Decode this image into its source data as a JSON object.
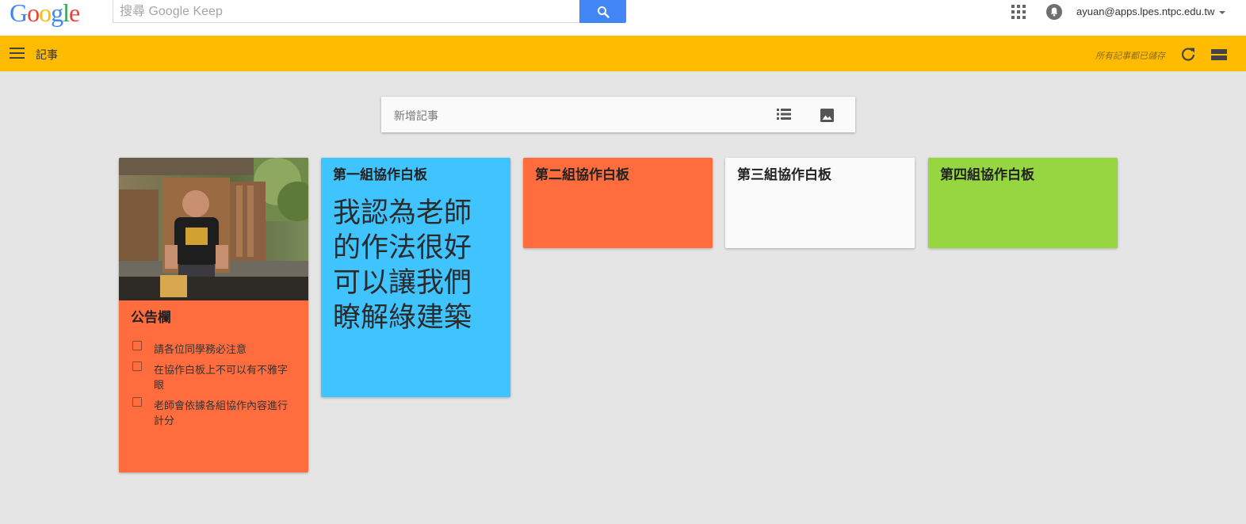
{
  "header": {
    "logo_letters": [
      "G",
      "o",
      "o",
      "g",
      "l",
      "e"
    ],
    "search_placeholder": "搜尋 Google Keep",
    "search_value": "",
    "account_email": "ayuan@apps.lpes.ntpc.edu.tw"
  },
  "appbar": {
    "title": "記事",
    "saved_status": "所有記事都已儲存"
  },
  "new_note": {
    "placeholder": "新增記事"
  },
  "notes": [
    {
      "title": "公告欄",
      "color": "#ff6d3f",
      "checklist": [
        {
          "text": "請各位同學務必注意",
          "checked": false
        },
        {
          "text": "在協作白板上不可以有不雅字眼",
          "checked": false
        },
        {
          "text": "老師會依據各組協作內容進行計分",
          "checked": false
        }
      ]
    },
    {
      "title": "第一組協作白板",
      "color": "#40c4ff",
      "body": "我認為老師的作法很好可以讓我們瞭解綠建築"
    },
    {
      "title": "第二組協作白板",
      "color": "#ff6d3f"
    },
    {
      "title": "第三組協作白板",
      "color": "#fafafa"
    },
    {
      "title": "第四組協作白板",
      "color": "#95d641"
    }
  ],
  "colors": {
    "google_blue": "#4285f4",
    "google_red": "#ea4335",
    "google_yellow": "#fbbc05",
    "google_green": "#34a853",
    "appbar": "#ffbb00",
    "background": "#e5e5e5"
  }
}
